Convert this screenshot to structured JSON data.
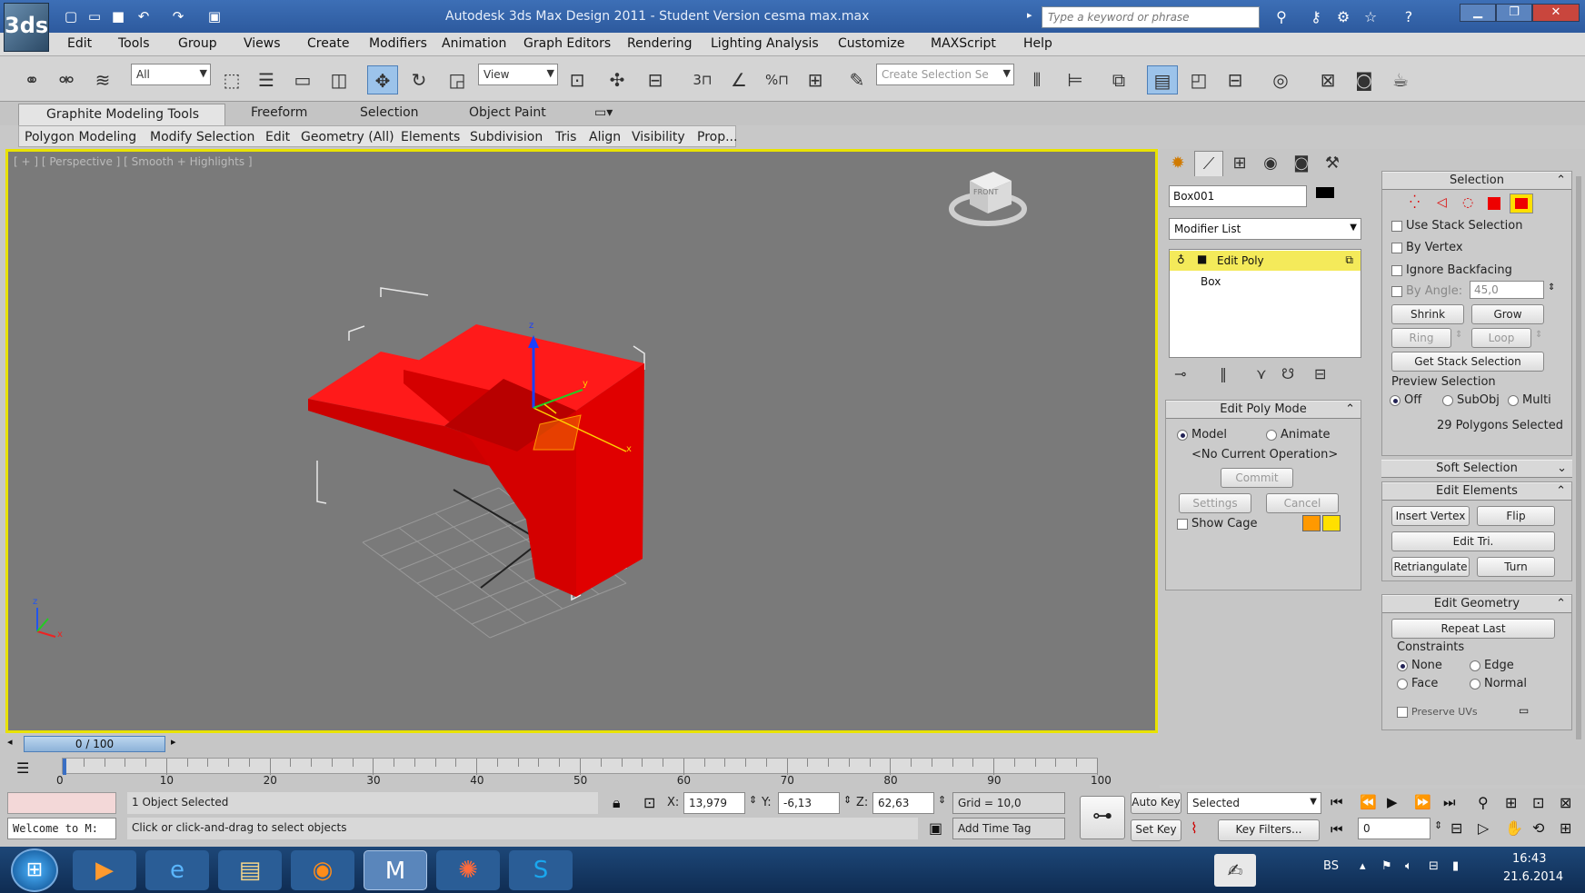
{
  "app": {
    "logo": "3ds",
    "title": "Autodesk 3ds Max Design 2011 - Student Version   cesma max.max"
  },
  "search": {
    "placeholder": "Type a keyword or phrase"
  },
  "menu": [
    "Edit",
    "Tools",
    "Group",
    "Views",
    "Create",
    "Modifiers",
    "Animation",
    "Graph Editors",
    "Rendering",
    "Lighting Analysis",
    "Customize",
    "MAXScript",
    "Help"
  ],
  "toolbar": {
    "filter": "All",
    "ref_coord": "View",
    "named_set_placeholder": "Create Selection Se"
  },
  "ribbon": {
    "tabs": [
      "Graphite Modeling Tools",
      "Freeform",
      "Selection",
      "Object Paint"
    ],
    "panels": [
      "Polygon Modeling",
      "Modify Selection",
      "Edit",
      "Geometry (All)",
      "Elements",
      "Subdivision",
      "Tris",
      "Align",
      "Visibility",
      "Prop..."
    ]
  },
  "viewport": {
    "label": "[ + ] [ Perspective ] [ Smooth + Highlights ]",
    "viewcube": "FRONT",
    "object_color": "#ee0000"
  },
  "command_panel": {
    "object_name": "Box001",
    "modifier_list": "Modifier List",
    "stack": [
      "Edit Poly",
      "Box"
    ],
    "edit_poly_mode": {
      "title": "Edit Poly Mode",
      "model": "Model",
      "animate": "Animate",
      "operation": "<No Current Operation>",
      "commit": "Commit",
      "settings": "Settings",
      "cancel": "Cancel",
      "show_cage": "Show Cage"
    },
    "selection": {
      "title": "Selection",
      "use_stack": "Use Stack Selection",
      "by_vertex": "By Vertex",
      "ignore_backfacing": "Ignore Backfacing",
      "by_angle": "By Angle:",
      "angle_value": "45,0",
      "shrink": "Shrink",
      "grow": "Grow",
      "ring": "Ring",
      "loop": "Loop",
      "get_stack": "Get Stack Selection",
      "preview": "Preview Selection",
      "off": "Off",
      "subobj": "SubObj",
      "multi": "Multi",
      "status": "29 Polygons Selected"
    },
    "soft_selection": "Soft Selection",
    "edit_elements": {
      "title": "Edit Elements",
      "insert_vertex": "Insert Vertex",
      "flip": "Flip",
      "edit_tri": "Edit Tri.",
      "retriangulate": "Retriangulate",
      "turn": "Turn"
    },
    "edit_geometry": {
      "title": "Edit Geometry",
      "repeat_last": "Repeat Last",
      "constraints": "Constraints",
      "none": "None",
      "edge": "Edge",
      "face": "Face",
      "normal": "Normal",
      "preserve_uvs": "Preserve UVs"
    }
  },
  "timeline": {
    "slider": "0 / 100",
    "progress": 0,
    "ticks": [
      "0",
      "10",
      "20",
      "30",
      "40",
      "50",
      "60",
      "70",
      "80",
      "90",
      "100"
    ]
  },
  "status": {
    "maxscript": "Welcome to M:",
    "selected": "1 Object Selected",
    "prompt": "Click or click-and-drag to select objects",
    "x_label": "X:",
    "x": "13,979",
    "y_label": "Y:",
    "y": "-6,13",
    "z_label": "Z:",
    "z": "62,63",
    "grid": "Grid = 10,0",
    "add_time_tag": "Add Time Tag",
    "auto_key": "Auto Key",
    "set_key": "Set Key",
    "key_mode": "Selected",
    "key_filters": "Key Filters...",
    "frame": "0"
  },
  "taskbar": {
    "lang": "BS",
    "time": "16:43",
    "date": "21.6.2014"
  }
}
